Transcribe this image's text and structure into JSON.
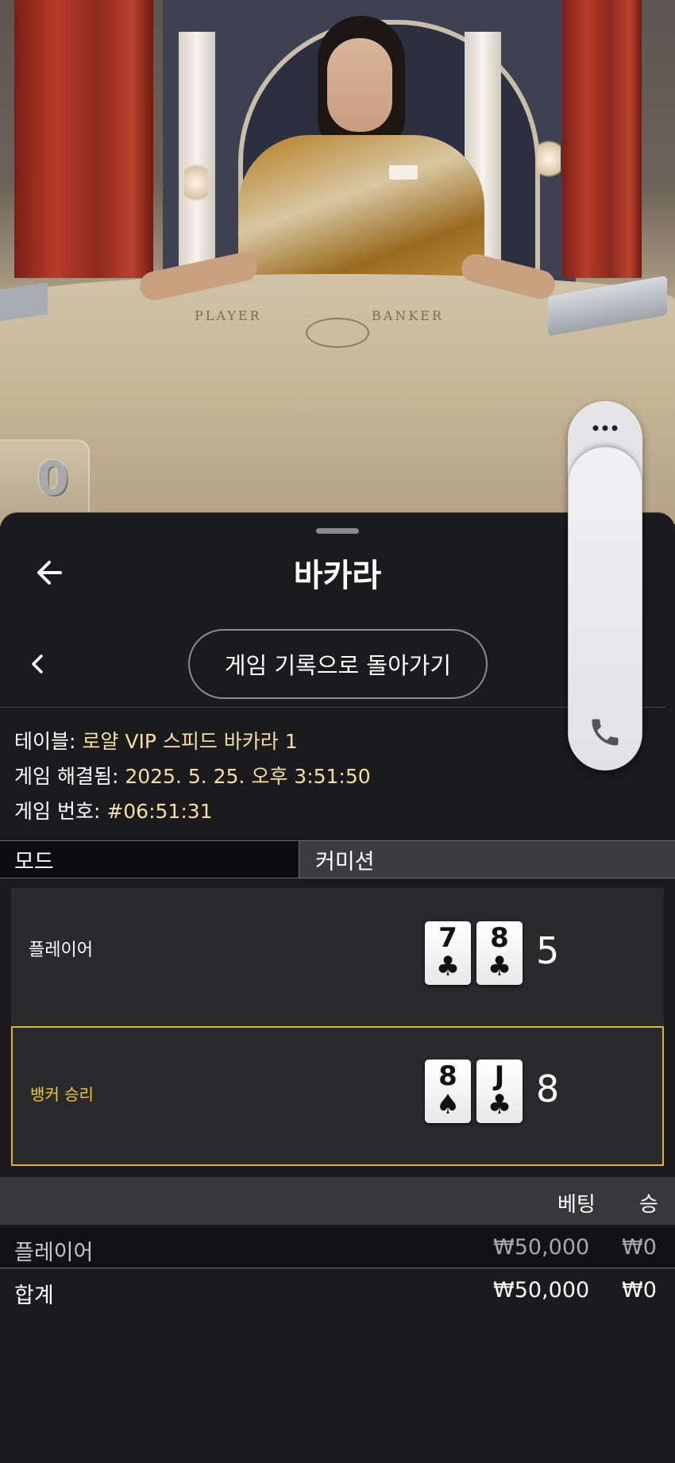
{
  "video": {
    "felt_player": "PLAYER",
    "felt_banker": "BANKER",
    "score": "0"
  },
  "header": {
    "title": "바카라",
    "back_icon": "arrow-left-icon"
  },
  "history": {
    "button_label": "게임 기록으로 돌아가기",
    "prev_icon": "chevron-left-icon"
  },
  "details": {
    "table_label": "테이블:",
    "table_value": "로얄 VIP 스피드 바카라 1",
    "resolved_label": "게임 해결됨:",
    "resolved_value": "2025. 5. 25. 오후 3:51:50",
    "number_label": "게임 번호:",
    "number_value": "#06:51:31"
  },
  "tabs": [
    {
      "label": "모드"
    },
    {
      "label": "커미션"
    }
  ],
  "results": {
    "player": {
      "label": "플레이어",
      "cards": [
        {
          "rank": "7",
          "suit": "♣"
        },
        {
          "rank": "8",
          "suit": "♣"
        }
      ],
      "total": "5"
    },
    "banker": {
      "label": "뱅커 승리",
      "cards": [
        {
          "rank": "8",
          "suit": "♠"
        },
        {
          "rank": "J",
          "suit": "♣"
        }
      ],
      "total": "8"
    }
  },
  "bets": {
    "headers": {
      "bet": "베팅",
      "win": "승"
    },
    "rows": [
      {
        "label": "플레이어",
        "bet": "₩50,000",
        "win": "₩0"
      }
    ],
    "total": {
      "label": "합계",
      "bet": "₩50,000",
      "win": "₩0"
    }
  },
  "side_panel": {
    "more_icon": "more-dots-icon",
    "phone_icon": "phone-icon"
  },
  "colors": {
    "accent_gold": "#f2c928",
    "value_text": "#f4dea2",
    "sheet_bg": "#1b1b1d"
  }
}
